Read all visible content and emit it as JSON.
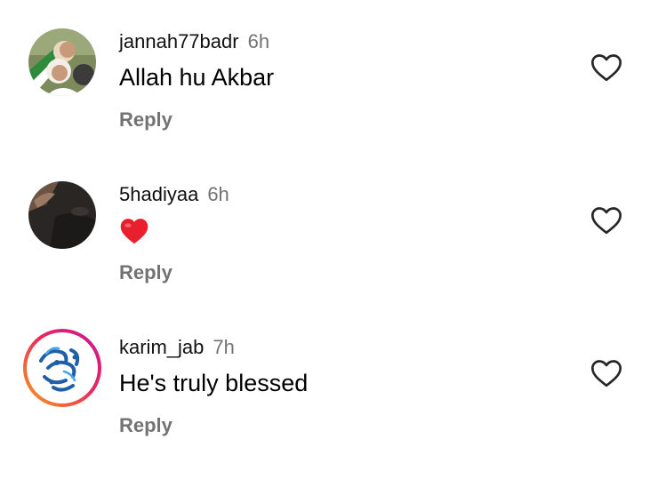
{
  "comments": [
    {
      "username": "jannah77badr",
      "time": "6h",
      "text": "Allah hu Akbar",
      "reply_label": "Reply",
      "avatar": "couple-photo-avatar"
    },
    {
      "username": "5hadiyaa",
      "time": "6h",
      "text": "",
      "emoji": "red-heart-emoji",
      "reply_label": "Reply",
      "avatar": "dark-photo-avatar"
    },
    {
      "username": "karim_jab",
      "time": "7h",
      "text": "He's truly blessed",
      "reply_label": "Reply",
      "avatar": "blue-calligraphy-logo-avatar-with-story-ring"
    }
  ],
  "icons": {
    "like": "heart-outline-icon"
  },
  "colors": {
    "secondary_text": "#737373",
    "heart_emoji": "#e8202e",
    "story_ring_start": "#f9a11b",
    "story_ring_end": "#c8169b",
    "logo_blue": "#1f5fa8"
  }
}
